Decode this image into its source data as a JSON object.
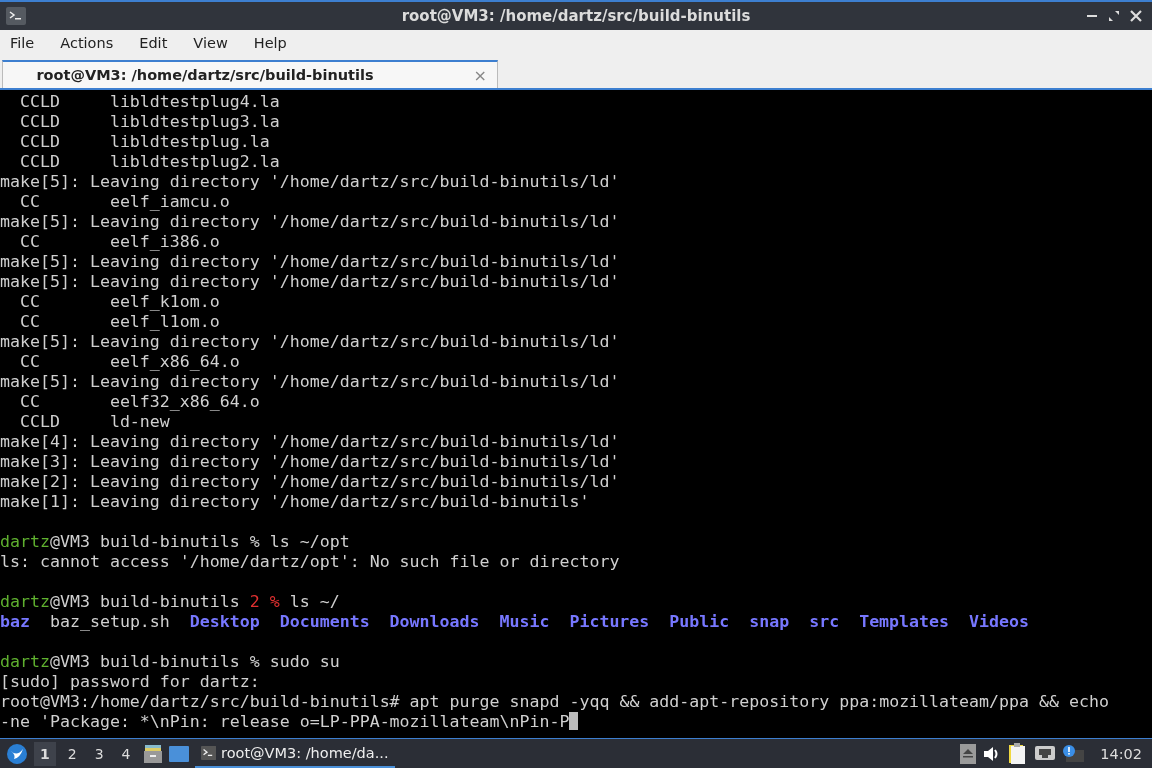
{
  "window": {
    "title": "root@VM3: /home/dartz/src/build-binutils"
  },
  "menu": [
    "File",
    "Actions",
    "Edit",
    "View",
    "Help"
  ],
  "tabs": [
    {
      "label": "root@VM3: /home/dartz/src/build-binutils",
      "selected": true,
      "close": "×"
    }
  ],
  "terminal": {
    "lines": [
      {
        "segments": [
          {
            "text": "  CCLD     libldtestplug4.la",
            "kind": "text"
          }
        ]
      },
      {
        "segments": [
          {
            "text": "  CCLD     libldtestplug3.la",
            "kind": "text"
          }
        ]
      },
      {
        "segments": [
          {
            "text": "  CCLD     libldtestplug.la",
            "kind": "text"
          }
        ]
      },
      {
        "segments": [
          {
            "text": "  CCLD     libldtestplug2.la",
            "kind": "text"
          }
        ]
      },
      {
        "segments": [
          {
            "text": "make[5]: Leaving directory '/home/dartz/src/build-binutils/ld'",
            "kind": "text"
          }
        ]
      },
      {
        "segments": [
          {
            "text": "  CC       eelf_iamcu.o",
            "kind": "text"
          }
        ]
      },
      {
        "segments": [
          {
            "text": "make[5]: Leaving directory '/home/dartz/src/build-binutils/ld'",
            "kind": "text"
          }
        ]
      },
      {
        "segments": [
          {
            "text": "  CC       eelf_i386.o",
            "kind": "text"
          }
        ]
      },
      {
        "segments": [
          {
            "text": "make[5]: Leaving directory '/home/dartz/src/build-binutils/ld'",
            "kind": "text"
          }
        ]
      },
      {
        "segments": [
          {
            "text": "make[5]: Leaving directory '/home/dartz/src/build-binutils/ld'",
            "kind": "text"
          }
        ]
      },
      {
        "segments": [
          {
            "text": "  CC       eelf_k1om.o",
            "kind": "text"
          }
        ]
      },
      {
        "segments": [
          {
            "text": "  CC       eelf_l1om.o",
            "kind": "text"
          }
        ]
      },
      {
        "segments": [
          {
            "text": "make[5]: Leaving directory '/home/dartz/src/build-binutils/ld'",
            "kind": "text"
          }
        ]
      },
      {
        "segments": [
          {
            "text": "  CC       eelf_x86_64.o",
            "kind": "text"
          }
        ]
      },
      {
        "segments": [
          {
            "text": "make[5]: Leaving directory '/home/dartz/src/build-binutils/ld'",
            "kind": "text"
          }
        ]
      },
      {
        "segments": [
          {
            "text": "  CC       eelf32_x86_64.o",
            "kind": "text"
          }
        ]
      },
      {
        "segments": [
          {
            "text": "  CCLD     ld-new",
            "kind": "text"
          }
        ]
      },
      {
        "segments": [
          {
            "text": "make[4]: Leaving directory '/home/dartz/src/build-binutils/ld'",
            "kind": "text"
          }
        ]
      },
      {
        "segments": [
          {
            "text": "make[3]: Leaving directory '/home/dartz/src/build-binutils/ld'",
            "kind": "text"
          }
        ]
      },
      {
        "segments": [
          {
            "text": "make[2]: Leaving directory '/home/dartz/src/build-binutils/ld'",
            "kind": "text"
          }
        ]
      },
      {
        "segments": [
          {
            "text": "make[1]: Leaving directory '/home/dartz/src/build-binutils'",
            "kind": "text"
          }
        ]
      },
      {
        "blank": true
      },
      {
        "segments": [
          {
            "text": "dartz",
            "kind": "user"
          },
          {
            "text": "@VM3 build-binutils % ls ~/opt",
            "kind": "text"
          }
        ]
      },
      {
        "segments": [
          {
            "text": "ls: cannot access '/home/dartz/opt': No such file or directory",
            "kind": "text"
          }
        ]
      },
      {
        "blank": true
      },
      {
        "segments": [
          {
            "text": "dartz",
            "kind": "user"
          },
          {
            "text": "@VM3 build-binutils ",
            "kind": "text"
          },
          {
            "text": "2 %",
            "kind": "alert"
          },
          {
            "text": " ls ~/",
            "kind": "text"
          }
        ]
      },
      {
        "listing": true,
        "segments": [
          {
            "text": "baz",
            "kind": "dir"
          },
          {
            "text": "baz_setup.sh",
            "kind": "text"
          },
          {
            "text": "Desktop",
            "kind": "dir"
          },
          {
            "text": "Documents",
            "kind": "dir"
          },
          {
            "text": "Downloads",
            "kind": "dir"
          },
          {
            "text": "Music",
            "kind": "dir"
          },
          {
            "text": "Pictures",
            "kind": "dir"
          },
          {
            "text": "Public",
            "kind": "dir"
          },
          {
            "text": "snap",
            "kind": "dir"
          },
          {
            "text": "src",
            "kind": "dir"
          },
          {
            "text": "Templates",
            "kind": "dir"
          },
          {
            "text": "Videos",
            "kind": "dir"
          }
        ]
      },
      {
        "blank": true
      },
      {
        "segments": [
          {
            "text": "dartz",
            "kind": "user"
          },
          {
            "text": "@VM3 build-binutils % sudo su",
            "kind": "text"
          }
        ]
      },
      {
        "segments": [
          {
            "text": "[sudo] password for dartz:",
            "kind": "text"
          }
        ]
      },
      {
        "segments": [
          {
            "text": "root@VM3:/home/dartz/src/build-binutils# apt purge snapd -yqq && add-apt-repository ppa:mozillateam/ppa && echo",
            "kind": "text"
          }
        ]
      },
      {
        "segments": [
          {
            "text": "-ne 'Package: *\\nPin: release o=LP-PPA-mozillateam\\nPin-P",
            "kind": "text"
          }
        ],
        "cursor": true
      }
    ]
  },
  "taskbar": {
    "workspaces": [
      {
        "label": "1",
        "selected": true
      },
      {
        "label": "2",
        "selected": false
      },
      {
        "label": "3",
        "selected": false
      },
      {
        "label": "4",
        "selected": false
      }
    ],
    "tasks": [
      {
        "label": "root@VM3: /home/da...",
        "selected": true
      }
    ],
    "clock": "14:02"
  }
}
